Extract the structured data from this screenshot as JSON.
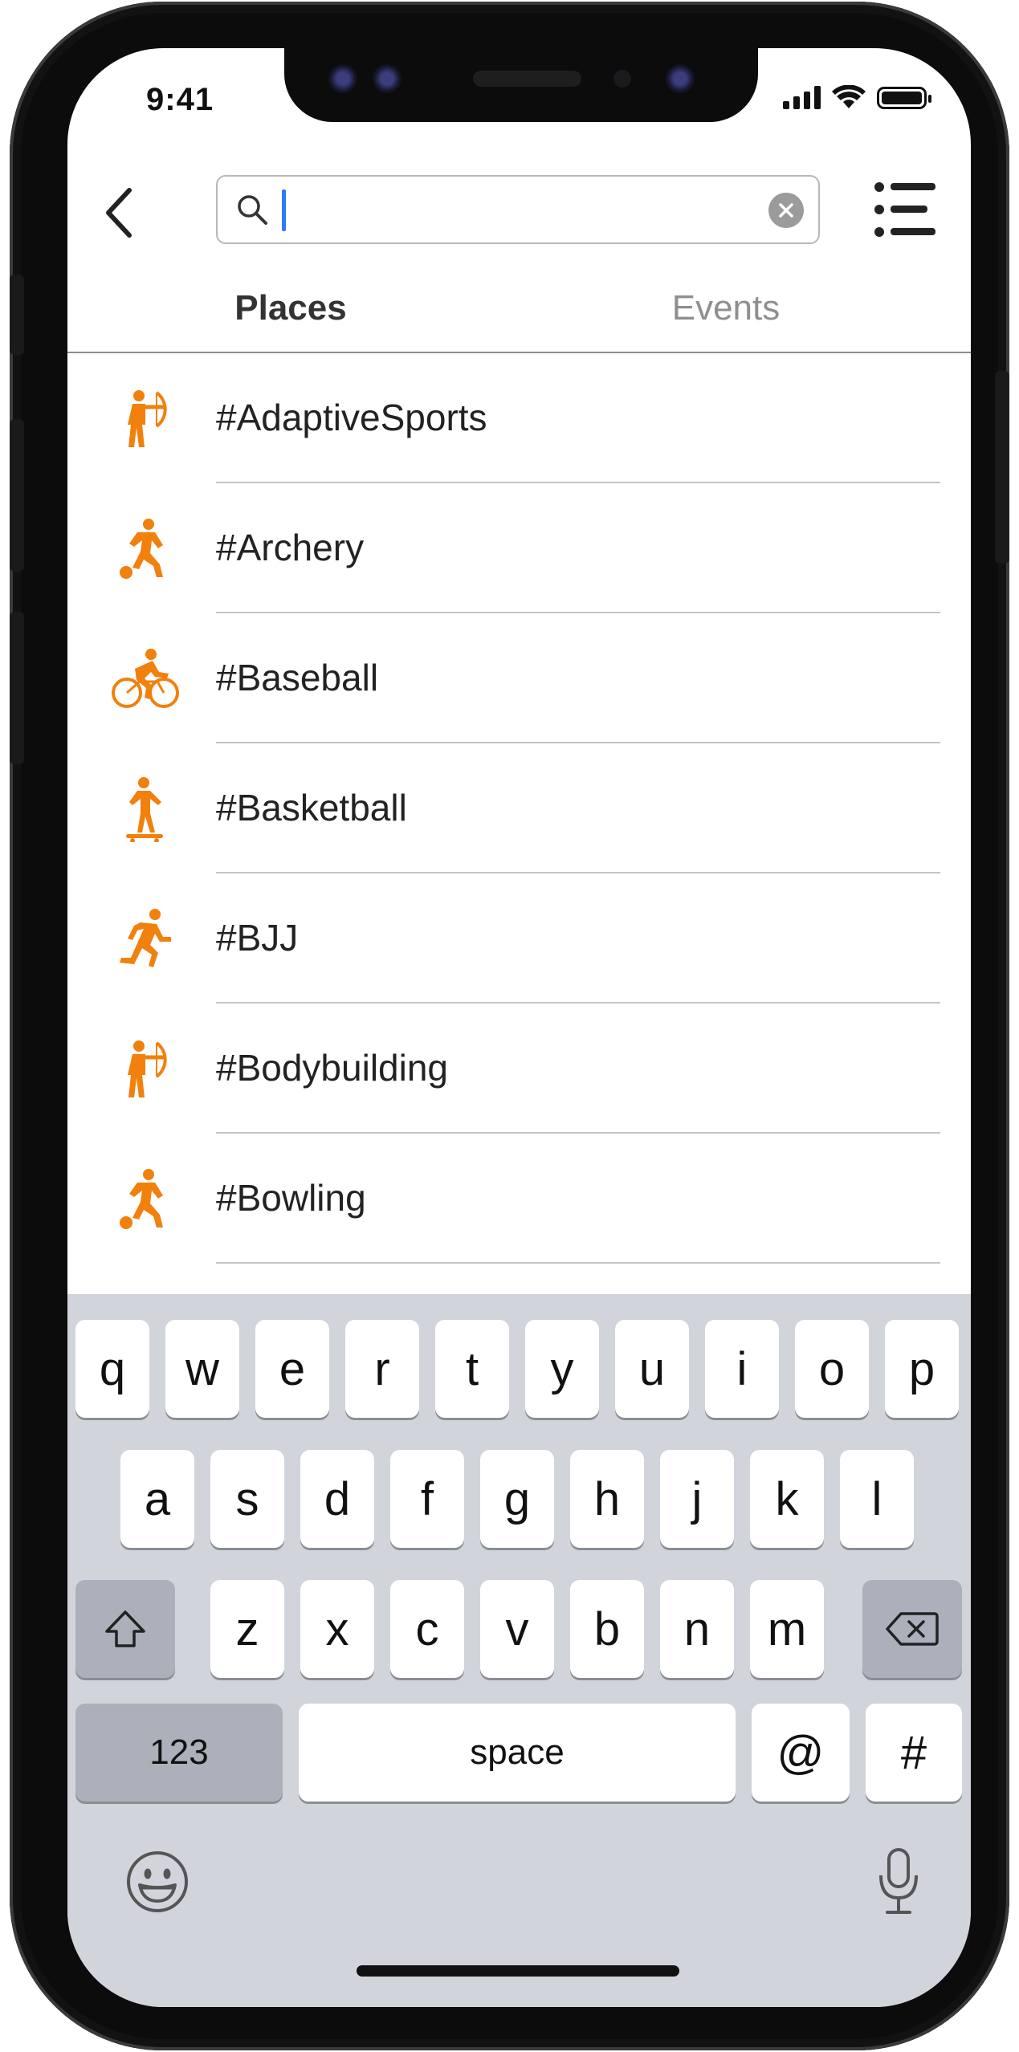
{
  "status_bar": {
    "time": "9:41"
  },
  "search": {
    "value": "",
    "placeholder": ""
  },
  "tabs": [
    {
      "label": "Places",
      "active": true
    },
    {
      "label": "Events",
      "active": false
    }
  ],
  "list": [
    {
      "label": "#AdaptiveSports",
      "icon": "archery-icon"
    },
    {
      "label": "#Archery",
      "icon": "soccer-player-icon"
    },
    {
      "label": "#Baseball",
      "icon": "cyclist-icon"
    },
    {
      "label": "#Basketball",
      "icon": "skateboarder-icon"
    },
    {
      "label": "#BJJ",
      "icon": "runner-icon"
    },
    {
      "label": "#Bodybuilding",
      "icon": "archery-icon"
    },
    {
      "label": "#Bowling",
      "icon": "soccer-player-icon"
    }
  ],
  "keyboard": {
    "row1": [
      "q",
      "w",
      "e",
      "r",
      "t",
      "y",
      "u",
      "i",
      "o",
      "p"
    ],
    "row2": [
      "a",
      "s",
      "d",
      "f",
      "g",
      "h",
      "j",
      "k",
      "l"
    ],
    "row3": [
      "z",
      "x",
      "c",
      "v",
      "b",
      "n",
      "m"
    ],
    "numbers_label": "123",
    "space_label": "space",
    "at_label": "@",
    "hash_label": "#"
  },
  "colors": {
    "accent": "#f2800c",
    "caret": "#2f7bf5",
    "keyboard_bg": "#d1d4db"
  }
}
